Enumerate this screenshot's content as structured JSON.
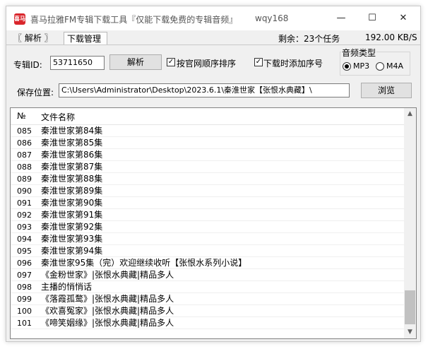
{
  "window": {
    "icon_text": "喜马",
    "title": "喜马拉雅FM专辑下载工具『仅能下载免费的专辑音频』",
    "user": "wqy168",
    "minimize": "—",
    "maximize": "☐",
    "close": "✕"
  },
  "tabs": [
    {
      "label": "〖 解析 〗"
    },
    {
      "label": "下载管理"
    }
  ],
  "status": {
    "remaining": "剩余：23个任务",
    "speed": "192.00 KB/S"
  },
  "form": {
    "album_id_label": "专辑ID:",
    "album_id_value": "53711650",
    "parse_button": "解析",
    "order_checkbox_label": "按官网顺序排序",
    "order_checked": true,
    "add_number_checkbox_label": "下载时添加序号",
    "add_number_checked": true,
    "audio_type_label": "音频类型",
    "audio_options": [
      {
        "label": "MP3",
        "selected": true
      },
      {
        "label": "M4A",
        "selected": false
      }
    ],
    "save_path_label": "保存位置:",
    "save_path_value": "C:\\Users\\Administrator\\Desktop\\2023.6.1\\秦淮世家【张恨水典藏】\\",
    "browse_button": "浏览"
  },
  "list": {
    "columns": [
      "№",
      "文件名称"
    ],
    "rows": [
      {
        "num": "085",
        "name": "秦淮世家第84集"
      },
      {
        "num": "086",
        "name": "秦淮世家第85集"
      },
      {
        "num": "087",
        "name": "秦淮世家第86集"
      },
      {
        "num": "088",
        "name": "秦淮世家第87集"
      },
      {
        "num": "089",
        "name": "秦淮世家第88集"
      },
      {
        "num": "090",
        "name": "秦淮世家第89集"
      },
      {
        "num": "091",
        "name": "秦淮世家第90集"
      },
      {
        "num": "092",
        "name": "秦淮世家第91集"
      },
      {
        "num": "093",
        "name": "秦淮世家第92集"
      },
      {
        "num": "094",
        "name": "秦淮世家第93集"
      },
      {
        "num": "095",
        "name": "秦淮世家第94集"
      },
      {
        "num": "096",
        "name": "秦淮世家95集（完）欢迎继续收听【张恨水系列小说】"
      },
      {
        "num": "097",
        "name": "《金粉世家》|张恨水典藏|精品多人"
      },
      {
        "num": "098",
        "name": "主播的悄悄话"
      },
      {
        "num": "099",
        "name": "《落霞孤鹜》|张恨水典藏|精品多人"
      },
      {
        "num": "100",
        "name": "《欢喜冤家》|张恨水典藏|精品多人"
      },
      {
        "num": "101",
        "name": "《啼笑姻缘》|张恨水典藏|精品多人"
      }
    ],
    "scroll_up": "▲",
    "scroll_down": "▼"
  }
}
